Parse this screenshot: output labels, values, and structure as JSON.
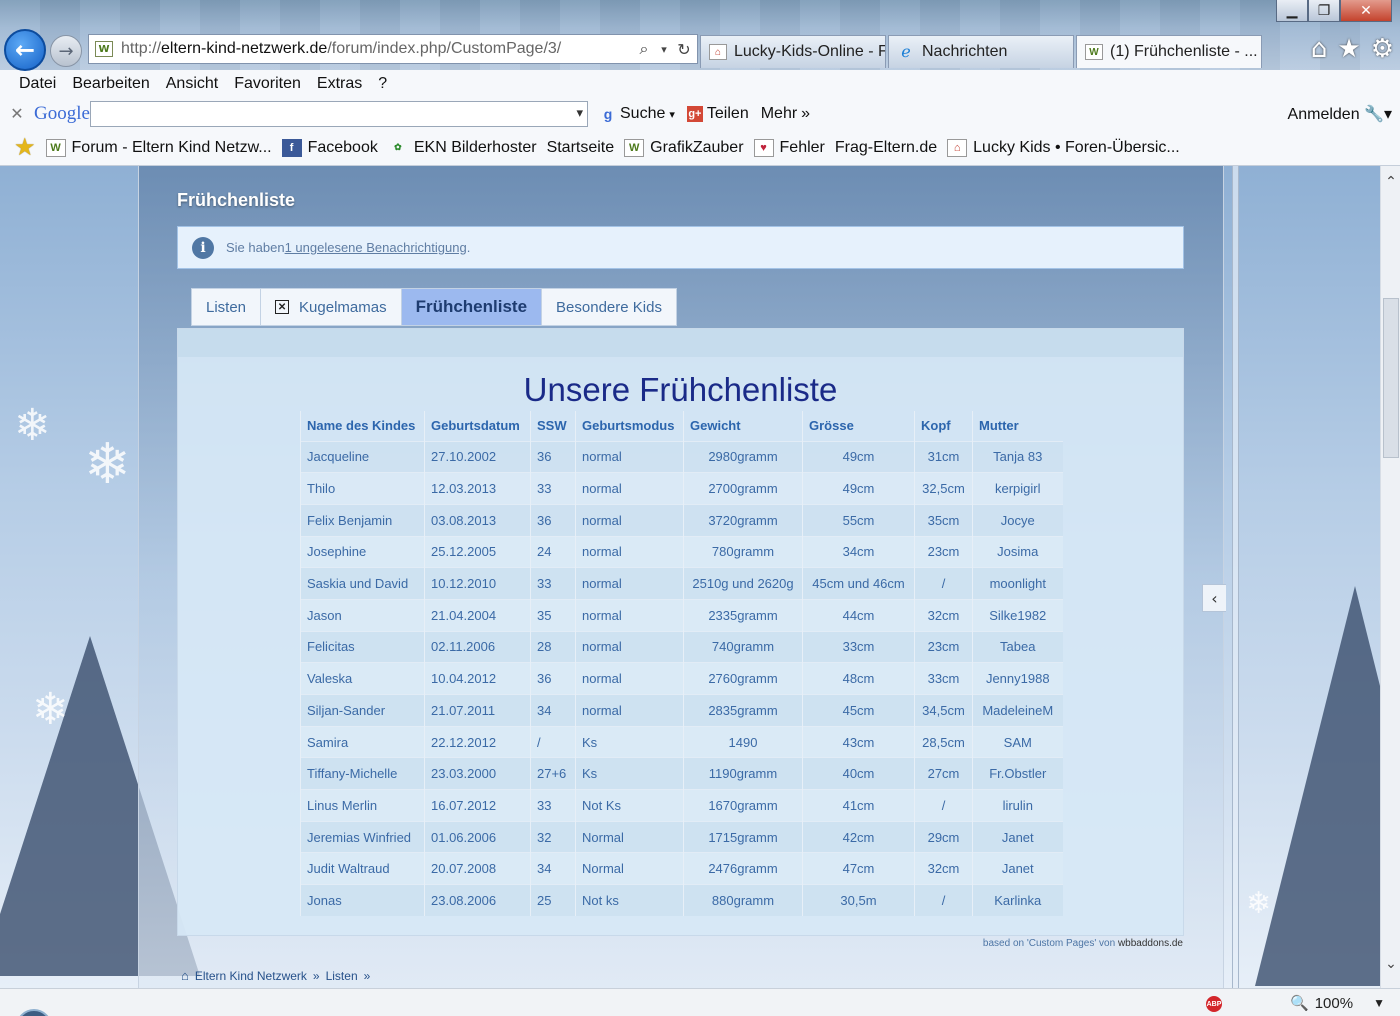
{
  "browser": {
    "address_url_prefix": "http://",
    "address_url_domain": "eltern-kind-netzwerk.de",
    "address_url_path": "/forum/index.php/CustomPage/3/",
    "tabs": [
      {
        "label": "Lucky-Kids-Online - F..."
      },
      {
        "label": "Nachrichten"
      },
      {
        "label": "(1) Frühchenliste - ..."
      }
    ],
    "menu": [
      "Datei",
      "Bearbeiten",
      "Ansicht",
      "Favoriten",
      "Extras",
      "?"
    ],
    "google": {
      "logo": "Google",
      "search_label": "Suche",
      "share_label": "Teilen",
      "more_label": "Mehr",
      "signin_label": "Anmelden"
    },
    "favorites": [
      {
        "label": "Forum - Eltern Kind Netzw..."
      },
      {
        "label": "Facebook"
      },
      {
        "label": "EKN Bilderhoster"
      },
      {
        "label": "Startseite"
      },
      {
        "label": "GrafikZauber"
      },
      {
        "label": "Fehler"
      },
      {
        "label": "Frag-Eltern.de"
      },
      {
        "label": "Lucky Kids • Foren-Übersic..."
      }
    ],
    "zoom": "100%"
  },
  "page": {
    "title": "Frühchenliste",
    "notice_prefix": "Sie haben ",
    "notice_link": "1 ungelesene Benachrichtigung",
    "notice_suffix": ".",
    "tabs": [
      {
        "label": "Listen"
      },
      {
        "label": "Kugelmamas"
      },
      {
        "label": "Frühchenliste"
      },
      {
        "label": "Besondere Kids"
      }
    ],
    "heading": "Unsere Frühchenliste",
    "columns": [
      "Name des Kindes",
      "Geburtsdatum",
      "SSW",
      "Geburtsmodus",
      "Gewicht",
      "Grösse",
      "Kopf",
      "Mutter"
    ],
    "rows": [
      [
        "Jacqueline",
        "27.10.2002",
        "36",
        "normal",
        "2980gramm",
        "49cm",
        "31cm",
        "Tanja 83"
      ],
      [
        "Thilo",
        "12.03.2013",
        "33",
        "normal",
        "2700gramm",
        "49cm",
        "32,5cm",
        "kerpigirl"
      ],
      [
        "Felix Benjamin",
        "03.08.2013",
        "36",
        "normal",
        "3720gramm",
        "55cm",
        "35cm",
        "Jocye"
      ],
      [
        "Josephine",
        "25.12.2005",
        "24",
        "normal",
        "780gramm",
        "34cm",
        "23cm",
        "Josima"
      ],
      [
        "Saskia und David",
        "10.12.2010",
        "33",
        "normal",
        "2510g und 2620g",
        "45cm und 46cm",
        "/",
        "moonlight"
      ],
      [
        "Jason",
        "21.04.2004",
        "35",
        "normal",
        "2335gramm",
        "44cm",
        "32cm",
        "Silke1982"
      ],
      [
        "Felicitas",
        "02.11.2006",
        "28",
        "normal",
        "740gramm",
        "33cm",
        "23cm",
        "Tabea"
      ],
      [
        "Valeska",
        "10.04.2012",
        "36",
        "normal",
        "2760gramm",
        "48cm",
        "33cm",
        "Jenny1988"
      ],
      [
        "Siljan-Sander",
        "21.07.2011",
        "34",
        "normal",
        "2835gramm",
        "45cm",
        "34,5cm",
        "MadeleineM"
      ],
      [
        "Samira",
        "22.12.2012",
        "/",
        "Ks",
        "1490",
        "43cm",
        "28,5cm",
        "SAM"
      ],
      [
        "Tiffany-Michelle",
        "23.03.2000",
        "27+6",
        "Ks",
        "1190gramm",
        "40cm",
        "27cm",
        "Fr.Obstler"
      ],
      [
        "Linus Merlin",
        "16.07.2012",
        "33",
        "Not Ks",
        "1670gramm",
        "41cm",
        "/",
        "lirulin"
      ],
      [
        "Jeremias Winfried",
        "01.06.2006",
        "32",
        "Normal",
        "1715gramm",
        "42cm",
        "29cm",
        "Janet"
      ],
      [
        "Judit Waltraud",
        "20.07.2008",
        "34",
        "Normal",
        "2476gramm",
        "47cm",
        "32cm",
        "Janet"
      ],
      [
        "Jonas",
        "23.08.2006",
        "25",
        "Not ks",
        "880gramm",
        "30,5m",
        "/",
        "Karlinka"
      ]
    ],
    "credit_prefix": "based on 'Custom Pages' von ",
    "credit_link": "wbbaddons.de",
    "breadcrumb": [
      {
        "label": "Eltern Kind Netzwerk"
      },
      {
        "label": "Listen"
      }
    ],
    "breadcrumb_sep": "»"
  }
}
